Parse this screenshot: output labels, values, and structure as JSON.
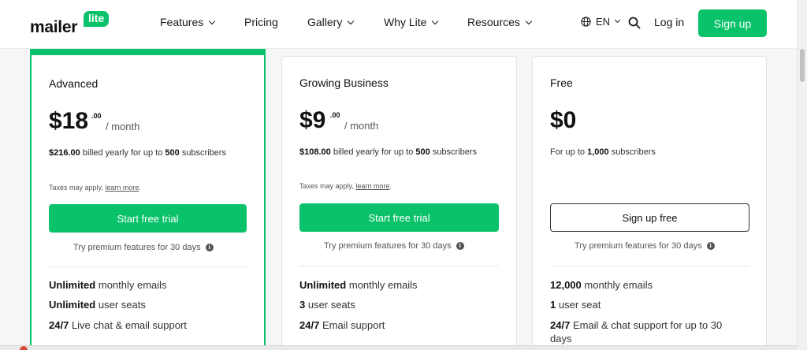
{
  "header": {
    "logo_word": "mailer",
    "logo_badge": "lite",
    "nav": [
      {
        "label": "Features",
        "dropdown": true
      },
      {
        "label": "Pricing",
        "dropdown": false
      },
      {
        "label": "Gallery",
        "dropdown": true
      },
      {
        "label": "Why Lite",
        "dropdown": true
      },
      {
        "label": "Resources",
        "dropdown": true
      }
    ],
    "language": "EN",
    "login": "Log in",
    "signup": "Sign up"
  },
  "colors": {
    "brand_green": "#09c269",
    "text_dark": "#111111",
    "text_muted": "#555555"
  },
  "plans": [
    {
      "name": "Advanced",
      "price": "$18",
      "cents": ".00",
      "period": "/ month",
      "billed_amount": "$216.00",
      "billed_text": "billed yearly for up to",
      "billed_subs": "500",
      "billed_suffix": "subscribers",
      "taxes": "Taxes may apply,",
      "learn_more": "learn more",
      "taxes_end": ".",
      "cta": "Start free trial",
      "try": "Try premium features for 30 days",
      "features": [
        {
          "strong": "Unlimited",
          "text": "monthly emails"
        },
        {
          "strong": "Unlimited",
          "text": "user seats"
        },
        {
          "strong": "24/7",
          "text": "Live chat & email support"
        }
      ]
    },
    {
      "name": "Growing Business",
      "price": "$9",
      "cents": ".00",
      "period": "/ month",
      "billed_amount": "$108.00",
      "billed_text": "billed yearly for up to",
      "billed_subs": "500",
      "billed_suffix": "subscribers",
      "taxes": "Taxes may apply,",
      "learn_more": "learn more",
      "taxes_end": ".",
      "cta": "Start free trial",
      "try": "Try premium features for 30 days",
      "features": [
        {
          "strong": "Unlimited",
          "text": "monthly emails"
        },
        {
          "strong": "3",
          "text": "user seats"
        },
        {
          "strong": "24/7",
          "text": "Email support"
        }
      ]
    },
    {
      "name": "Free",
      "price": "$0",
      "subs_prefix": "For up to",
      "subs_count": "1,000",
      "subs_suffix": "subscribers",
      "cta": "Sign up free",
      "try": "Try premium features for 30 days",
      "features": [
        {
          "strong": "12,000",
          "text": "monthly emails"
        },
        {
          "strong": "1",
          "text": "user seat"
        },
        {
          "strong": "24/7",
          "text": "Email & chat support for up to 30 days"
        }
      ]
    }
  ],
  "info_glyph": "i"
}
